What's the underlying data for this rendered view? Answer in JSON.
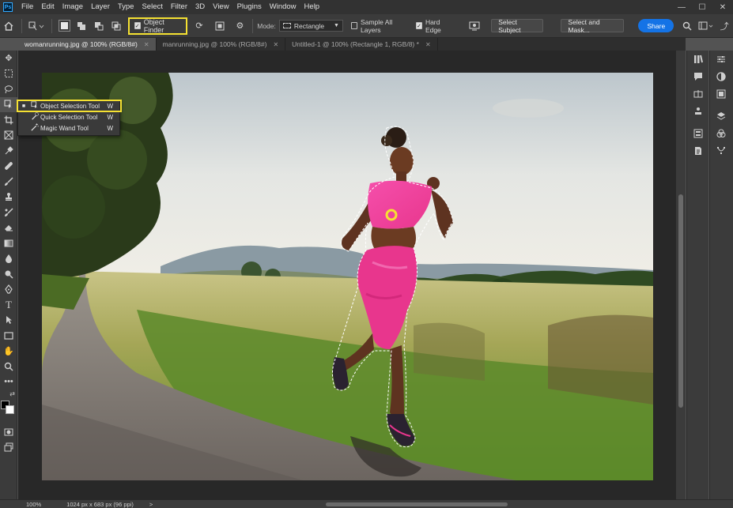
{
  "app": {
    "logo": "Ps"
  },
  "menu": [
    "File",
    "Edit",
    "Image",
    "Layer",
    "Type",
    "Select",
    "Filter",
    "3D",
    "View",
    "Plugins",
    "Window",
    "Help"
  ],
  "window_controls": {
    "minimize": "—",
    "maximize": "☐",
    "close": "✕"
  },
  "options_bar": {
    "object_finder_label": "Object Finder",
    "mode_label": "Mode:",
    "mode_value": "Rectangle",
    "sample_all_layers_label": "Sample All Layers",
    "sample_all_layers_checked": false,
    "hard_edge_label": "Hard Edge",
    "hard_edge_checked": true,
    "select_subject_label": "Select Subject",
    "select_and_mask_label": "Select and Mask...",
    "share_label": "Share"
  },
  "tabs": [
    {
      "label": "womanrunning.jpg @ 100% (RGB/8#)",
      "active": true
    },
    {
      "label": "manrunning.jpg @ 100% (RGB/8#)",
      "active": false
    },
    {
      "label": "Untitled-1 @ 100% (Rectangle 1, RGB/8) *",
      "active": false
    }
  ],
  "tool_flyout": [
    {
      "label": "Object Selection Tool",
      "key": "W",
      "selected": true,
      "icon": "object-selection-icon"
    },
    {
      "label": "Quick Selection Tool",
      "key": "W",
      "selected": false,
      "icon": "quick-selection-icon"
    },
    {
      "label": "Magic Wand Tool",
      "key": "W",
      "selected": false,
      "icon": "magic-wand-icon"
    }
  ],
  "status": {
    "zoom": "100%",
    "doc_info": "1024 px x 683 px (96 ppi)",
    "arrow": ">"
  },
  "colors": {
    "accent": "#1473e6",
    "highlight": "#f5e132",
    "panel": "#3b3b3b",
    "foreground": "#000000",
    "background": "#ffffff"
  }
}
